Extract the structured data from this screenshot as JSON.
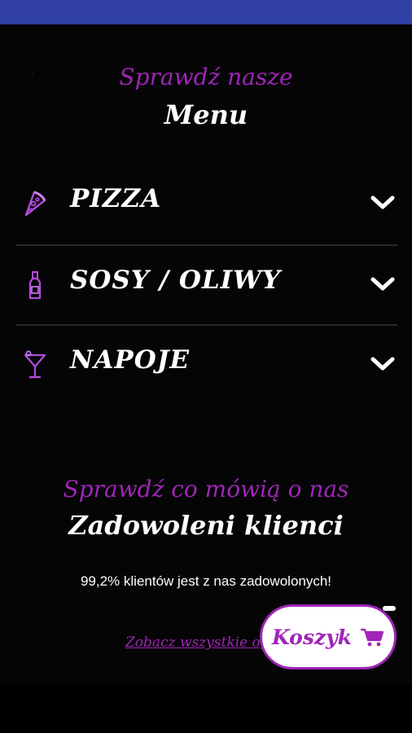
{
  "header": {
    "subtitle": "Sprawdź nasze",
    "title": "Menu"
  },
  "menu": {
    "items": [
      {
        "label": "PIZZA",
        "icon": "pizza-slice-icon"
      },
      {
        "label": "SOSY / OLIWY",
        "icon": "bottle-icon"
      },
      {
        "label": "NAPOJE",
        "icon": "cocktail-icon"
      }
    ]
  },
  "reviews": {
    "subtitle": "Sprawdź co mówią o nas",
    "title": "Zadowoleni klienci",
    "satisfaction_text": "99,2% klientów jest z nas zadowolonych!",
    "see_all_link": "Zobacz wszystkie opinie"
  },
  "cart": {
    "label": "Koszyk",
    "icon": "cart-icon"
  },
  "colors": {
    "accent": "#a025b8",
    "status_bar": "#2f3fa4",
    "background": "#050505"
  }
}
